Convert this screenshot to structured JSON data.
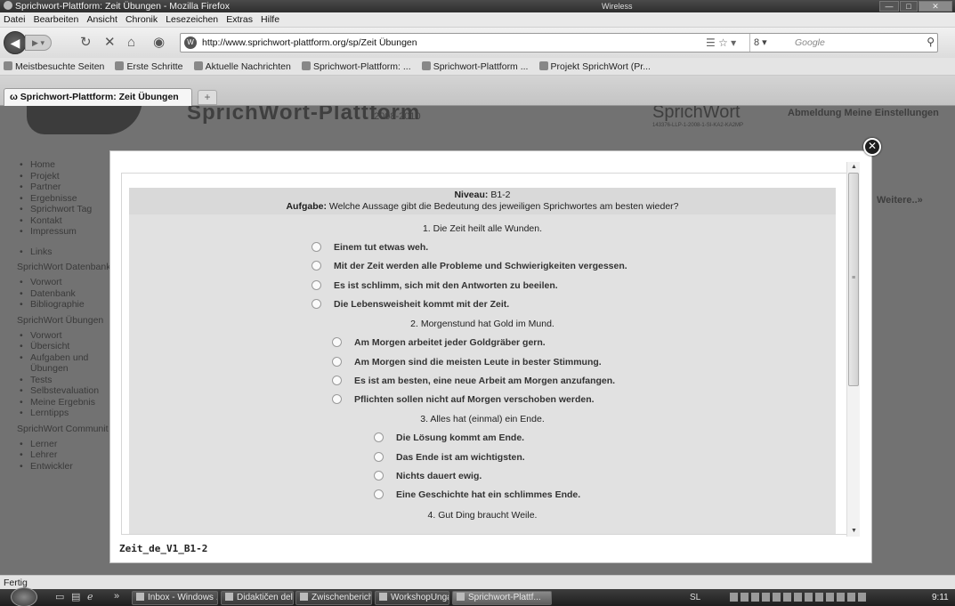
{
  "window": {
    "title": "Sprichwort-Plattform: Zeit Übungen - Mozilla Firefox",
    "network": "Wireless"
  },
  "menu": [
    "Datei",
    "Bearbeiten",
    "Ansicht",
    "Chronik",
    "Lesezeichen",
    "Extras",
    "Hilfe"
  ],
  "nav": {
    "url": "http://www.sprichwort-plattform.org/sp/Zeit Übungen",
    "search_placeholder": "Google"
  },
  "bookmarks": [
    "Meistbesuchte Seiten",
    "Erste Schritte",
    "Aktuelle Nachrichten",
    "Sprichwort-Plattform: ...",
    "Sprichwort-Plattform ...",
    "Projekt SprichWort (Pr..."
  ],
  "tabs": [
    {
      "label": "Sprichwort-Plattform: Zeit Übungen"
    }
  ],
  "background_page": {
    "logo": "SprichWort-Plattform",
    "years": "2008-2010",
    "brand": "SprichWort",
    "project_code": "143376-LLP-1-2008-1-SI-KA2-KA2MP",
    "links": "Abmeldung   Meine Einstellungen",
    "more": "Weitere..»",
    "sidebar": [
      {
        "kind": "item",
        "text": "Home"
      },
      {
        "kind": "item",
        "text": "Projekt"
      },
      {
        "kind": "item",
        "text": "Partner"
      },
      {
        "kind": "item",
        "text": "Ergebnisse"
      },
      {
        "kind": "item",
        "text": "Sprichwort Tag"
      },
      {
        "kind": "item",
        "text": "Kontakt"
      },
      {
        "kind": "item",
        "text": "Impressum"
      },
      {
        "kind": "gap"
      },
      {
        "kind": "item",
        "text": "Links"
      },
      {
        "kind": "section",
        "text": "SprichWort Datenbank"
      },
      {
        "kind": "item",
        "text": "Vorwort"
      },
      {
        "kind": "item",
        "text": "Datenbank"
      },
      {
        "kind": "item",
        "text": "Bibliographie"
      },
      {
        "kind": "section",
        "text": "SprichWort Übungen"
      },
      {
        "kind": "item",
        "text": "Vorwort"
      },
      {
        "kind": "item",
        "text": "Übersicht"
      },
      {
        "kind": "item",
        "text": "Aufgaben und"
      },
      {
        "kind": "cont",
        "text": "Übungen"
      },
      {
        "kind": "item",
        "text": "Tests"
      },
      {
        "kind": "item",
        "text": "Selbstevaluation"
      },
      {
        "kind": "item",
        "text": "Meine Ergebnis"
      },
      {
        "kind": "item",
        "text": "Lerntipps"
      },
      {
        "kind": "section",
        "text": "SprichWort Communit"
      },
      {
        "kind": "item",
        "text": "Lerner"
      },
      {
        "kind": "item",
        "text": "Lehrer"
      },
      {
        "kind": "item",
        "text": "Entwickler"
      }
    ]
  },
  "exercise": {
    "level_label": "Niveau:",
    "level": "B1-2",
    "task_label": "Aufgabe:",
    "task": "Welche Aussage gibt die Bedeutung des jeweiligen Sprichwortes am besten wieder?",
    "questions": [
      {
        "title": "1. Die Zeit heilt alle Wunden.",
        "options": [
          "Einem tut etwas weh.",
          "Mit der Zeit werden alle Probleme und Schwierigkeiten vergessen.",
          "Es ist schlimm, sich mit den Antworten zu beeilen.",
          "Die Lebensweisheit kommt mit der Zeit."
        ]
      },
      {
        "title": "2. Morgenstund hat Gold im Mund.",
        "options": [
          "Am Morgen arbeitet jeder Goldgräber gern.",
          "Am Morgen sind die meisten Leute in bester Stimmung.",
          "Es ist am besten, eine neue Arbeit am Morgen anzufangen.",
          "Pflichten sollen nicht auf Morgen verschoben werden."
        ]
      },
      {
        "title": "3. Alles hat (einmal) ein Ende.",
        "options": [
          "Die Lösung kommt am Ende.",
          "Das Ende ist am wichtigsten.",
          "Nichts dauert ewig.",
          "Eine Geschichte hat ein schlimmes Ende."
        ]
      },
      {
        "title": "4. Gut Ding braucht Weile.",
        "options": []
      }
    ]
  },
  "modal": {
    "caption": "Zeit_de_V1_B1-2",
    "close_symbol": "✕"
  },
  "status": "Fertig",
  "taskbar": {
    "items": [
      {
        "label": "Inbox - Windows ...",
        "active": false
      },
      {
        "label": "Didaktičen del pr...",
        "active": false
      },
      {
        "label": "Zwischenbericht z...",
        "active": false
      },
      {
        "label": "WorkshopUngarn...",
        "active": false
      },
      {
        "label": "Sprichwort-Plattf...",
        "active": true
      }
    ],
    "language": "SL",
    "clock": "9:11"
  }
}
